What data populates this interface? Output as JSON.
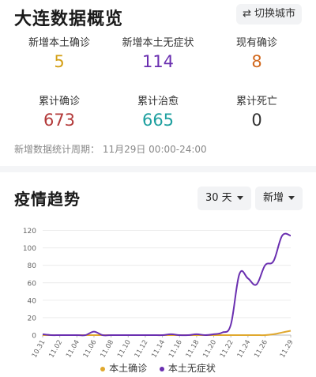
{
  "header": {
    "title": "大连数据概览",
    "switch_label": "切换城市"
  },
  "stats": [
    {
      "label": "新增本土确诊",
      "value": "5",
      "color": "#d4a017"
    },
    {
      "label": "新增本土无症状",
      "value": "114",
      "color": "#6a2fb0"
    },
    {
      "label": "现有确诊",
      "value": "8",
      "color": "#d2691e"
    },
    {
      "label": "累计确诊",
      "value": "673",
      "color": "#b33a3a"
    },
    {
      "label": "累计治愈",
      "value": "665",
      "color": "#1fa0a0"
    },
    {
      "label": "累计死亡",
      "value": "0",
      "color": "#333333"
    }
  ],
  "period": "新增数据统计周期： 11月29日 00:00-24:00",
  "trend": {
    "title": "疫情趋势",
    "range_label": "30 天",
    "mode_label": "新增"
  },
  "chart_data": {
    "type": "line",
    "x": [
      "10.31",
      "11.01",
      "11.02",
      "11.03",
      "11.04",
      "11.05",
      "11.06",
      "11.07",
      "11.08",
      "11.09",
      "11.10",
      "11.11",
      "11.12",
      "11.13",
      "11.14",
      "11.15",
      "11.16",
      "11.17",
      "11.18",
      "11.19",
      "11.20",
      "11.21",
      "11.22",
      "11.23",
      "11.24",
      "11.25",
      "11.26",
      "11.27",
      "11.28",
      "11.29"
    ],
    "tick_labels": [
      "10.31",
      "11.02",
      "11.04",
      "11.06",
      "11.08",
      "11.10",
      "11.12",
      "11.14",
      "11.16",
      "11.18",
      "11.20",
      "11.22",
      "11.24",
      "11.26",
      "11.29"
    ],
    "y_ticks": [
      0,
      20,
      40,
      60,
      80,
      100,
      120
    ],
    "ylim": [
      0,
      125
    ],
    "series": [
      {
        "name": "本土确诊",
        "color": "#e0a82e",
        "values": [
          0,
          0,
          0,
          0,
          0,
          0,
          0,
          0,
          0,
          0,
          0,
          0,
          0,
          0,
          0,
          0,
          0,
          0,
          0,
          0,
          0,
          0,
          0,
          0,
          0,
          0,
          0,
          1,
          3,
          5
        ]
      },
      {
        "name": "本土无症状",
        "color": "#6a2fb0",
        "values": [
          1,
          0,
          0,
          0,
          0,
          0,
          4,
          0,
          0,
          0,
          0,
          0,
          0,
          0,
          0,
          1,
          0,
          0,
          1,
          0,
          1,
          3,
          12,
          70,
          65,
          58,
          80,
          85,
          114,
          114
        ]
      }
    ]
  }
}
